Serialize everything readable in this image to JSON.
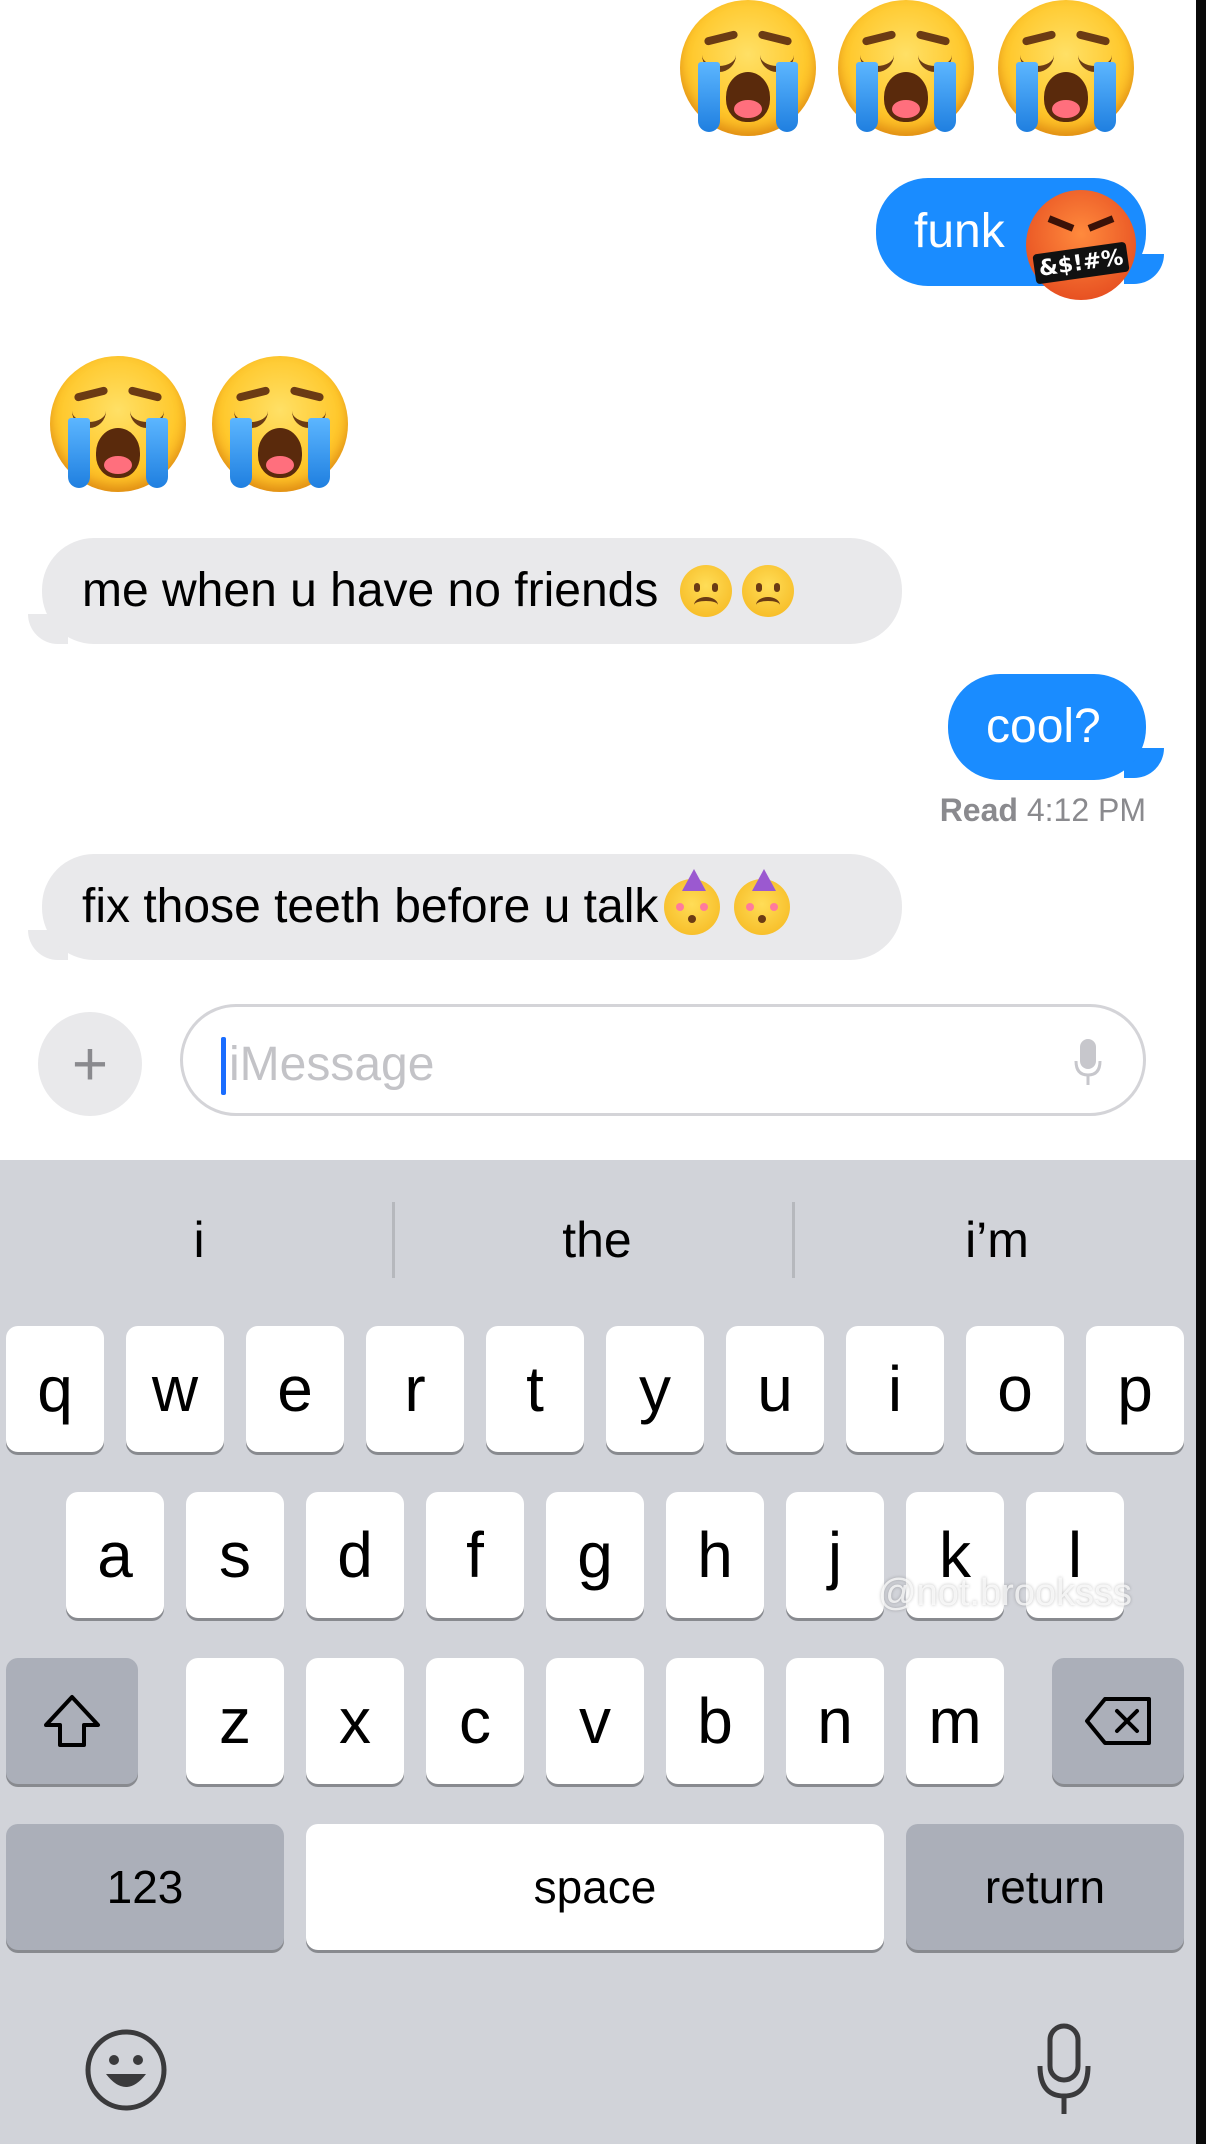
{
  "conversation": {
    "messages": [
      {
        "type": "emoji",
        "side": "out",
        "emojis": [
          "loudly-crying-face",
          "loudly-crying-face",
          "loudly-crying-face"
        ]
      },
      {
        "type": "text",
        "side": "out",
        "text": "funk",
        "emoji": "cursing-face"
      },
      {
        "type": "emoji",
        "side": "in",
        "emojis": [
          "loudly-crying-face",
          "loudly-crying-face"
        ]
      },
      {
        "type": "text",
        "side": "in",
        "text": "me when u have no friends",
        "emojis": [
          "frowning-face",
          "frowning-face"
        ]
      },
      {
        "type": "text",
        "side": "out",
        "text": "cool?"
      },
      {
        "type": "text",
        "side": "in",
        "text": "fix those teeth before u talk",
        "emojis": [
          "partying-face",
          "partying-face"
        ]
      }
    ],
    "read_receipt": {
      "label": "Read",
      "time": "4:12 PM"
    },
    "cursing_symbols": "&$!#%"
  },
  "compose": {
    "placeholder": "iMessage",
    "plus_label": "+"
  },
  "keyboard": {
    "suggestions": [
      "i",
      "the",
      "i’m"
    ],
    "row1": [
      "q",
      "w",
      "e",
      "r",
      "t",
      "y",
      "u",
      "i",
      "o",
      "p"
    ],
    "row2": [
      "a",
      "s",
      "d",
      "f",
      "g",
      "h",
      "j",
      "k",
      "l"
    ],
    "row3": [
      "z",
      "x",
      "c",
      "v",
      "b",
      "n",
      "m"
    ],
    "numbers_label": "123",
    "space_label": "space",
    "return_label": "return"
  },
  "watermark": "@not.brooksss",
  "colors": {
    "outgoing_bubble": "#1a8cff",
    "incoming_bubble": "#e9e9eb",
    "keyboard_bg": "#d1d3d9"
  }
}
